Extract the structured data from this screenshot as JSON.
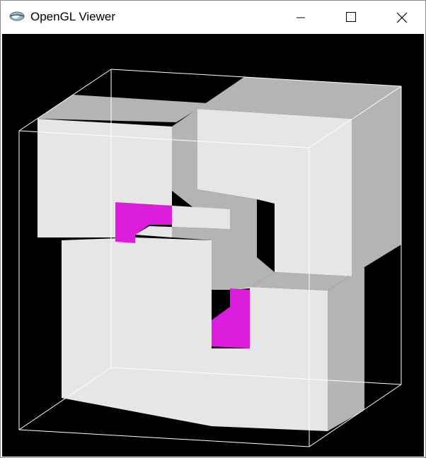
{
  "window": {
    "title": "OpenGL Viewer",
    "icons": {
      "app": "gl-logo-icon",
      "minimize": "minimize-icon",
      "maximize": "maximize-icon",
      "close": "close-icon"
    }
  },
  "viewport": {
    "background": "#000000"
  },
  "colors": {
    "face_light": "#e6e6e6",
    "face_shadow": "#b4b4b4",
    "highlight": "#dc1edc",
    "wireframe": "#ffffff"
  }
}
